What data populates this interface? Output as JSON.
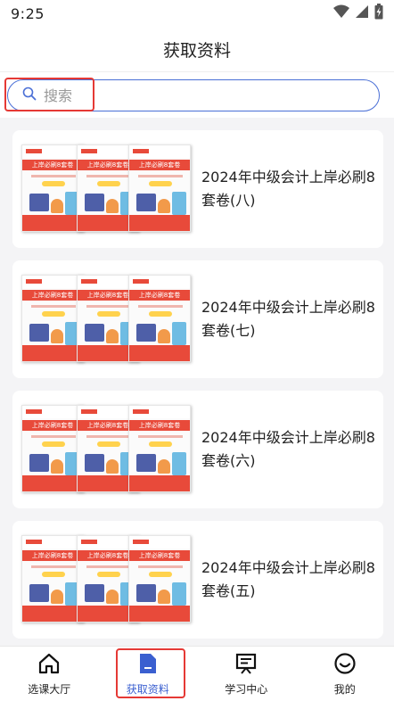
{
  "status_bar": {
    "time": "9:25",
    "icons": [
      "wifi-icon",
      "signal-icon",
      "battery-charging-icon"
    ]
  },
  "header": {
    "title": "获取资料"
  },
  "search": {
    "placeholder": "搜索",
    "value": "",
    "icon": "search-icon"
  },
  "colors": {
    "accent": "#3a5fd0",
    "highlight": "#e53935",
    "book_red": "#e84a3a"
  },
  "materials": [
    {
      "title": "2024年中级会计上岸必刷8套卷(八)",
      "cover_text": "上岸必刷8套卷"
    },
    {
      "title": "2024年中级会计上岸必刷8套卷(七)",
      "cover_text": "上岸必刷8套卷"
    },
    {
      "title": "2024年中级会计上岸必刷8套卷(六)",
      "cover_text": "上岸必刷8套卷"
    },
    {
      "title": "2024年中级会计上岸必刷8套卷(五)",
      "cover_text": "上岸必刷8套卷"
    }
  ],
  "tabs": [
    {
      "label": "选课大厅",
      "icon": "home-icon",
      "active": false
    },
    {
      "label": "获取资料",
      "icon": "document-icon",
      "active": true
    },
    {
      "label": "学习中心",
      "icon": "study-board-icon",
      "active": false
    },
    {
      "label": "我的",
      "icon": "smile-profile-icon",
      "active": false
    }
  ]
}
